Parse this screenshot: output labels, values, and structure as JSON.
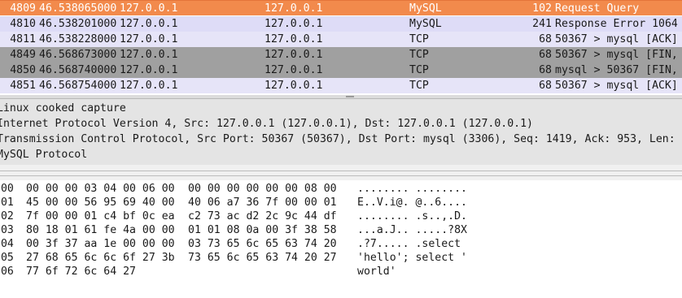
{
  "packet_list": {
    "rows": [
      {
        "no": "4809",
        "time": "46.538065000",
        "src": "127.0.0.1",
        "dst": "127.0.0.1",
        "proto": "MySQL",
        "len": "102",
        "info": "Request Query",
        "style": "sel"
      },
      {
        "no": "4810",
        "time": "46.538201000",
        "src": "127.0.0.1",
        "dst": "127.0.0.1",
        "proto": "MySQL",
        "len": "241",
        "info": "Response Error 1064",
        "style": "mysql"
      },
      {
        "no": "4811",
        "time": "46.538228000",
        "src": "127.0.0.1",
        "dst": "127.0.0.1",
        "proto": "TCP",
        "len": "68",
        "info": "50367 > mysql [ACK]",
        "style": "tcp"
      },
      {
        "no": "4849",
        "time": "46.568673000",
        "src": "127.0.0.1",
        "dst": "127.0.0.1",
        "proto": "TCP",
        "len": "68",
        "info": "50367 > mysql [FIN,",
        "style": "fin"
      },
      {
        "no": "4850",
        "time": "46.568740000",
        "src": "127.0.0.1",
        "dst": "127.0.0.1",
        "proto": "TCP",
        "len": "68",
        "info": "mysql > 50367 [FIN,",
        "style": "fin"
      },
      {
        "no": "4851",
        "time": "46.568754000",
        "src": "127.0.0.1",
        "dst": "127.0.0.1",
        "proto": "TCP",
        "len": "68",
        "info": "50367 > mysql [ACK]",
        "style": "tcp"
      }
    ]
  },
  "details": {
    "lines": [
      "Linux cooked capture",
      "Internet Protocol Version 4, Src: 127.0.0.1 (127.0.0.1), Dst: 127.0.0.1 (127.0.0.1)",
      "Transmission Control Protocol, Src Port: 50367 (50367), Dst Port: mysql (3306), Seq: 1419, Ack: 953, Len: 34",
      "MySQL Protocol"
    ]
  },
  "bytes": {
    "rows": [
      {
        "offset": "0000",
        "hex1": "00 00 00 03 04 00 06 00",
        "hex2": "00 00 00 00 00 00 08 00",
        "ascii": "........ ........"
      },
      {
        "offset": "0010",
        "hex1": "45 00 00 56 95 69 40 00",
        "hex2": "40 06 a7 36 7f 00 00 01",
        "ascii": "E..V.i@. @..6...."
      },
      {
        "offset": "0020",
        "hex1": "7f 00 00 01 c4 bf 0c ea",
        "hex2": "c2 73 ac d2 2c 9c 44 df",
        "ascii": "........ .s..,.D."
      },
      {
        "offset": "0030",
        "hex1": "80 18 01 61 fe 4a 00 00",
        "hex2": "01 01 08 0a 00 3f 38 58",
        "ascii": "...a.J.. .....?8X"
      },
      {
        "offset": "0040",
        "hex1": "00 3f 37 aa 1e 00 00 00",
        "hex2": "03 73 65 6c 65 63 74 20",
        "ascii": ".?7..... .select "
      },
      {
        "offset": "0050",
        "hex1": "27 68 65 6c 6c 6f 27 3b",
        "hex2": "73 65 6c 65 63 74 20 27",
        "ascii": "'hello'; select '"
      },
      {
        "offset": "0060",
        "hex1": "77 6f 72 6c 64 27",
        "hex2": "",
        "ascii": "world'"
      }
    ]
  }
}
